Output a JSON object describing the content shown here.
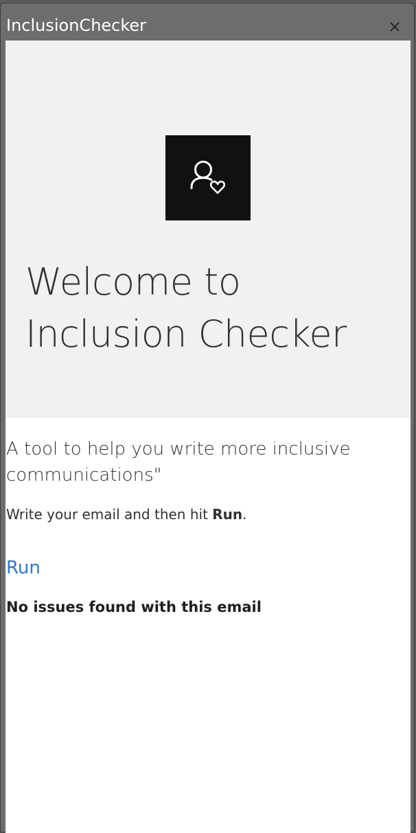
{
  "window": {
    "title": "InclusionChecker",
    "close_icon": "close-icon"
  },
  "hero": {
    "logo_icon": "person-heart-icon",
    "heading": "Welcome to Inclusion Checker"
  },
  "main": {
    "subtitle": "A tool to help you write more inclusive communications\"",
    "instruction_prefix": "Write your email and then hit ",
    "instruction_bold": "Run",
    "instruction_suffix": ".",
    "run_label": "Run",
    "result_text": "No issues found with this email"
  },
  "colors": {
    "accent": "#2b79d0",
    "hero_bg": "#f2f1f0",
    "logo_bg": "#111111",
    "titlebar_bg": "#6d6d6d"
  }
}
